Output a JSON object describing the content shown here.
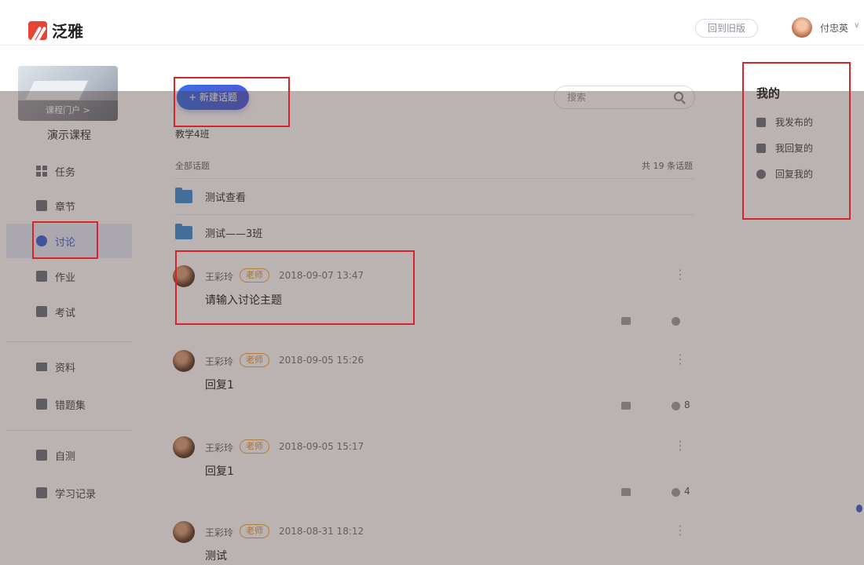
{
  "header": {
    "logo_text": "泛雅",
    "old_version_label": "回到旧版",
    "user_name": "付忠英",
    "chevron": "∨"
  },
  "sidebar": {
    "course_portal_label": "课程门户 >",
    "course_name": "演示课程",
    "items": [
      {
        "label": "任务",
        "icon": "grid-icon"
      },
      {
        "label": "章节",
        "icon": "list-icon"
      },
      {
        "label": "讨论",
        "icon": "discussion-icon",
        "active": true
      },
      {
        "label": "作业",
        "icon": "edit-icon"
      },
      {
        "label": "考试",
        "icon": "exam-icon"
      },
      {
        "label": "资料",
        "icon": "folder-icon"
      },
      {
        "label": "错题集",
        "icon": "wrong-icon"
      },
      {
        "label": "自测",
        "icon": "self-test-icon"
      },
      {
        "label": "学习记录",
        "icon": "record-icon"
      }
    ]
  },
  "main": {
    "new_topic_label": "+ 新建话题",
    "search_placeholder": "搜索",
    "class_name": "教学4班",
    "all_topics_label": "全部话题",
    "topic_count_label": "共 19 条话题",
    "folders": [
      {
        "name": "测试查看"
      },
      {
        "name": "测试——3班"
      }
    ],
    "posts": [
      {
        "author": "王彩玲",
        "badge": "老师",
        "time": "2018-09-07 13:47",
        "title": "请输入讨论主题",
        "comments": ""
      },
      {
        "author": "王彩玲",
        "badge": "老师",
        "time": "2018-09-05 15:26",
        "title": "回复1",
        "comments": "8"
      },
      {
        "author": "王彩玲",
        "badge": "老师",
        "time": "2018-09-05 15:17",
        "title": "回复1",
        "comments": "4"
      },
      {
        "author": "王彩玲",
        "badge": "老师",
        "time": "2018-08-31 18:12",
        "title": "测试",
        "comments": ""
      }
    ],
    "more_glyph": "⋮"
  },
  "mine": {
    "title": "我的",
    "items": [
      {
        "label": "我发布的",
        "icon": "publish-icon"
      },
      {
        "label": "我回复的",
        "icon": "reply-icon"
      },
      {
        "label": "回复我的",
        "icon": "replied-to-me-icon"
      }
    ]
  },
  "colors": {
    "accent": "#3a63d8",
    "highlight_box": "#d8232a",
    "teacher_badge": "#e99528",
    "folder": "#3f8fd9",
    "logo": "#e64535"
  }
}
